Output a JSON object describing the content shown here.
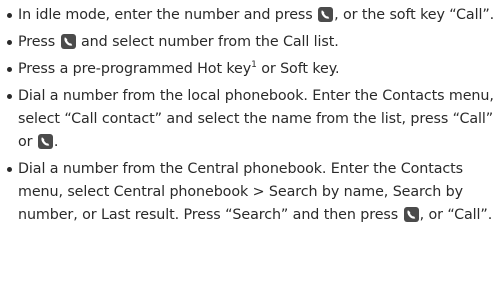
{
  "items": [
    {
      "text_a": "In idle mode, enter the number and press ",
      "icon": "call-key-icon",
      "text_b": ", or the soft key “Call”."
    },
    {
      "text_a": "Press ",
      "icon": "call-key-icon",
      "text_b": " and select number from the Call list."
    },
    {
      "text_a": "Press a pre-programmed Hot key",
      "sup": "1",
      "text_b": " or Soft key."
    },
    {
      "text_a": "Dial a number from the local phonebook. Enter the  Contacts menu, select “Call contact” and select the name from the list, press “Call” or ",
      "icon": "call-key-icon",
      "text_b": "."
    },
    {
      "text_a": "Dial a number from the Central phonebook. Enter the Contacts menu, select Central phonebook > Search by name, Search by number, or Last result. Press “Search” and then press ",
      "icon": "call-key-icon",
      "text_b": ", or  “Call”."
    }
  ]
}
